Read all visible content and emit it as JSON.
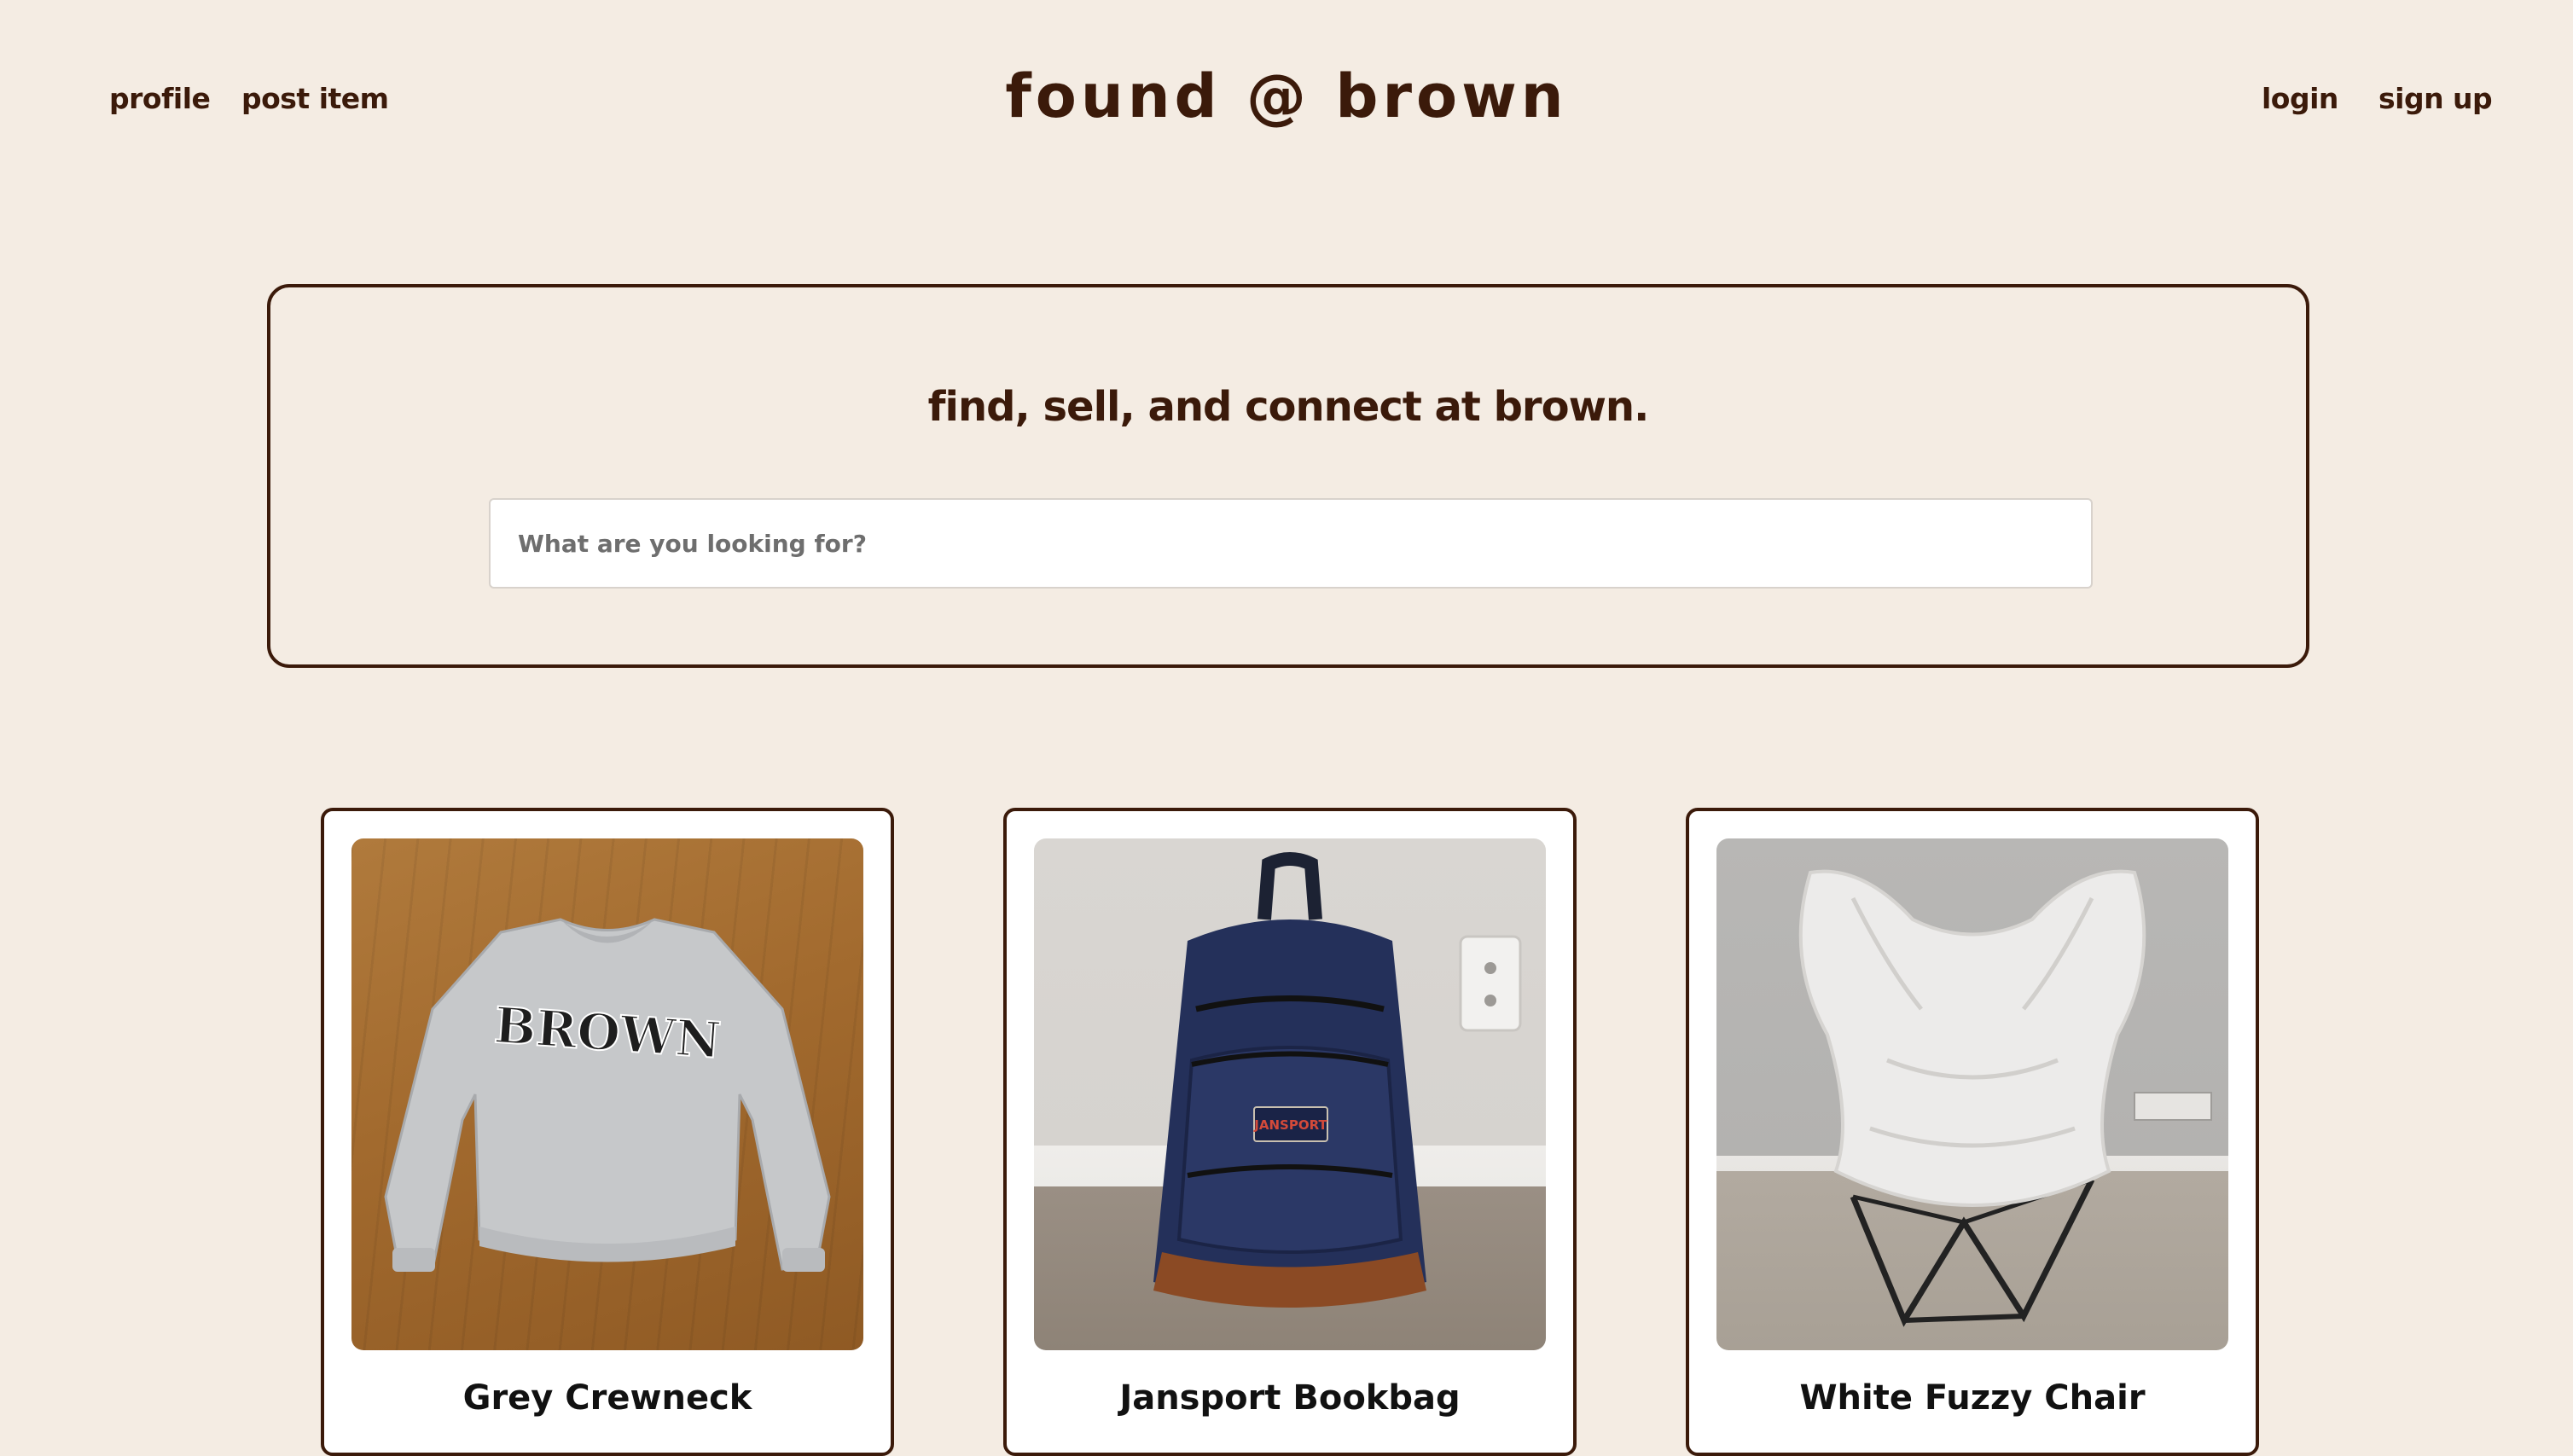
{
  "nav": {
    "left": {
      "profile_label": "profile",
      "post_item_label": "post item"
    },
    "right": {
      "login_label": "login",
      "signup_label": "sign up"
    }
  },
  "site": {
    "title": "found @ brown"
  },
  "hero": {
    "heading": "find, sell, and connect at brown.",
    "search_placeholder": "What are you looking for?",
    "search_value": ""
  },
  "listings": [
    {
      "title": "Grey Crewneck",
      "image_icon": "sweatshirt-photo",
      "image_text": "BROWN"
    },
    {
      "title": "Jansport Bookbag",
      "image_icon": "backpack-photo",
      "image_text": "JANSPORT"
    },
    {
      "title": "White Fuzzy Chair",
      "image_icon": "chair-photo"
    }
  ],
  "colors": {
    "background": "#f4ece3",
    "brand_brown": "#3b1a0a",
    "card_background": "#ffffff"
  }
}
